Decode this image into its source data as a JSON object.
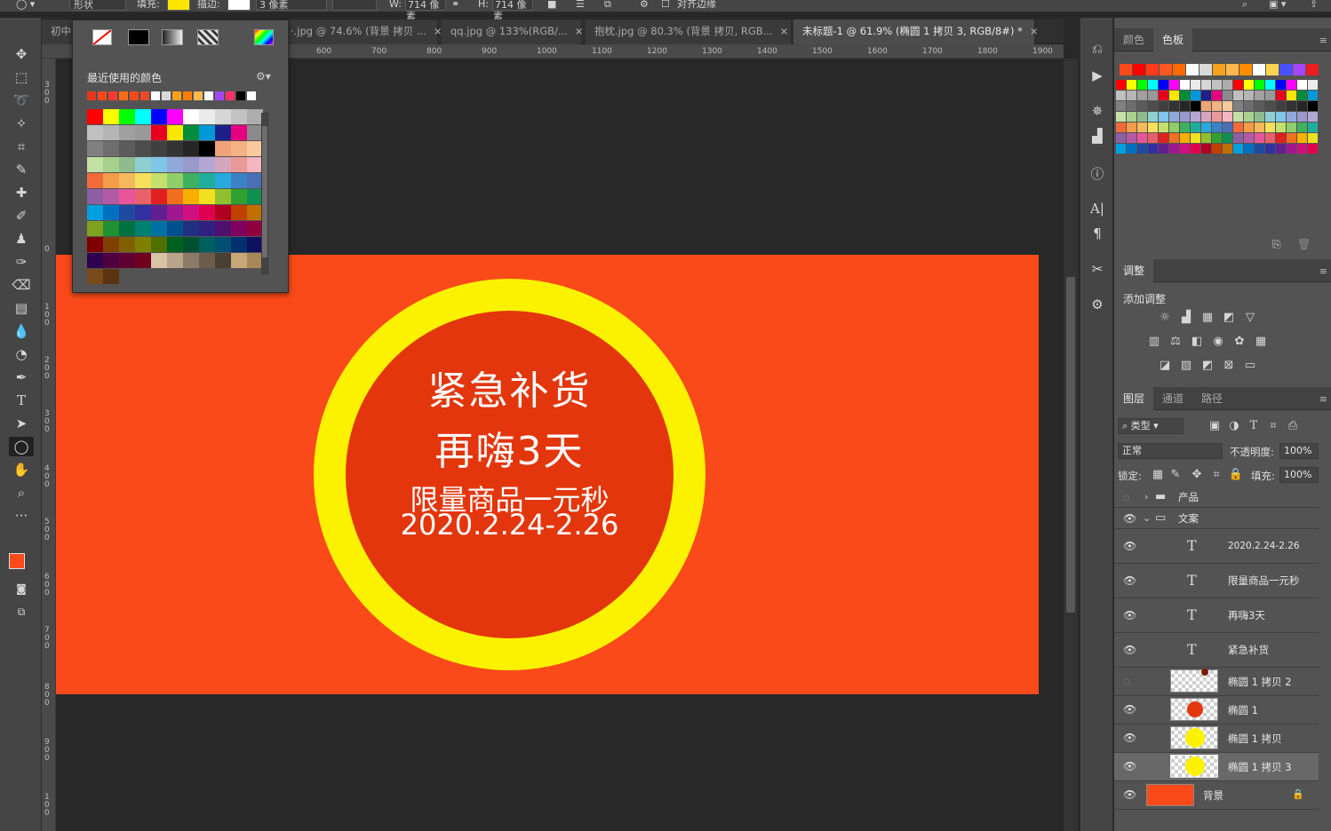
{
  "options_bar": {
    "shape_mode": "形状",
    "fill_label": "填充:",
    "fill_color": "#ffe600",
    "stroke_label": "描边:",
    "stroke_size": "3 像素",
    "width_label": "W:",
    "width_value": "714 像素",
    "height_label": "H:",
    "height_value": "714 像素",
    "align_edges_label": "对齐边缘"
  },
  "tabs": [
    {
      "label": "初中",
      "close": ""
    },
    {
      "label": "·.jpg @ 74.6% (背景 拷贝 ...",
      "close": "×"
    },
    {
      "label": "qq.jpg @ 133%(RGB/...",
      "close": "×"
    },
    {
      "label": "抱枕.jpg @ 80.3% (背景 拷贝, RGB...",
      "close": "×"
    },
    {
      "label": "未标题-1 @ 61.9% (椭圆 1 拷贝 3, RGB/8#) *",
      "close": "×"
    }
  ],
  "ruler": {
    "h_ticks": [
      "600",
      "700",
      "800",
      "900",
      "1000",
      "1100",
      "1200",
      "1300",
      "1400",
      "1500",
      "1600",
      "1700",
      "1800",
      "1900"
    ],
    "v_ticks": [
      "3\n0\n0",
      "0",
      "1\n0\n0",
      "2\n0\n0",
      "3\n0\n0",
      "4\n0\n0",
      "5\n0\n0",
      "6\n0\n0",
      "7\n0\n0",
      "8\n0\n0",
      "9\n0\n0",
      "1\n0\n0"
    ]
  },
  "canvas": {
    "bg_color": "#fb4a19",
    "ring_color": "#fcf200",
    "inner_color": "#e3360c",
    "line1": "紧急补货",
    "line2": "再嗨3天",
    "line3": "限量商品一元秒",
    "line4": "2020.2.24-2.26"
  },
  "swatch_popup": {
    "recent_label": "最近使用的颜色",
    "recent": [
      "#e5371b",
      "#fb4a19",
      "#ff3b30",
      "#ff6b1a",
      "#fb4a19",
      "#e94a27",
      "#ffffff",
      "#d9d9d9",
      "#f7a11c",
      "#ff7f00",
      "#ffb84d",
      "#ffffff",
      "#a347ff",
      "#ff3366",
      "#000000",
      "#ffffff"
    ],
    "grid": [
      [
        "#ff0000",
        "#ffff00",
        "#00ff00",
        "#00ffff",
        "#0000ff",
        "#ff00ff",
        "#ffffff",
        "#ebebeb",
        "#d6d6d6",
        "#c2c2c2",
        "#adadad"
      ],
      [
        "#c0c0c0",
        "#b5b5b5",
        "#a0a0a0",
        "#999999",
        "#e6001e",
        "#ffe600",
        "#008c3a",
        "#0098d9",
        "#1d2088",
        "#e5007f",
        "#8a8a8a"
      ],
      [
        "#808080",
        "#6e6e6e",
        "#5c5c5c",
        "#4d4d4d",
        "#404040",
        "#333333",
        "#262626",
        "#000000",
        "#f0a37a",
        "#f4b183",
        "#f9cb9c"
      ],
      [
        "#c5e0a5",
        "#a9d18e",
        "#8fbc8f",
        "#8ecfd1",
        "#7fc6e8",
        "#8fa9db",
        "#9999cc",
        "#b4a7d6",
        "#d5a6bd",
        "#ea9999",
        "#f4b6c2"
      ],
      [
        "#f26b3a",
        "#f39c4a",
        "#f5b85a",
        "#f7e15c",
        "#c4df6b",
        "#8fce6a",
        "#3fb05e",
        "#1fae9e",
        "#29a8dd",
        "#3b82c4",
        "#4a6fb5"
      ],
      [
        "#8e5ea2",
        "#b35aa5",
        "#e8559a",
        "#e8606a",
        "#e02020",
        "#f07020",
        "#f8b000",
        "#f0e020",
        "#90c030",
        "#30a030",
        "#109050"
      ],
      [
        "#00a0e0",
        "#0070c0",
        "#1e4aa0",
        "#3030a0",
        "#602090",
        "#a01890",
        "#d01080",
        "#e00050",
        "#b00020",
        "#c04000",
        "#c07000"
      ],
      [
        "#80a020",
        "#209030",
        "#007040",
        "#008070",
        "#0070a0",
        "#005090",
        "#203080",
        "#302080",
        "#501070",
        "#800060",
        "#900040"
      ],
      [
        "#800000",
        "#7f3f00",
        "#806000",
        "#808000",
        "#4f6f00",
        "#006020",
        "#005030",
        "#006060",
        "#004f70",
        "#003070",
        "#101060"
      ],
      [
        "#300050",
        "#500040",
        "#600030",
        "#700020",
        "#d9c3a5",
        "#b8a48a",
        "#8c7b66",
        "#6b5c4b",
        "#4a3f33",
        "#c8a878",
        "#a88858"
      ],
      [
        "#7a4b1a",
        "#5a3410",
        "",
        "",
        "",
        "",
        "",
        "",
        "",
        "",
        ""
      ]
    ]
  },
  "panels": {
    "color_tab": "颜色",
    "swatches_tab": "色板",
    "swatch_top": [
      "#fb4a19",
      "#ff0000",
      "#ff3b1a",
      "#ff5722",
      "#ff6a00",
      "#ffffff",
      "#d9d9d9",
      "#f7a11c",
      "#ffb84d",
      "#ff8c00",
      "#ffffff",
      "#ffd54f",
      "#4a52ff",
      "#a347ff",
      "#e91e1e"
    ],
    "adjust_tab": "调整",
    "add_adjust": "添加调整",
    "layers_tab": "图层",
    "channels_tab": "通道",
    "paths_tab": "路径",
    "filter_kind": "类型",
    "blend_mode": "正常",
    "opacity_label": "不透明度:",
    "opacity_value": "100%",
    "lock_label": "锁定:",
    "fill_label": "填充:",
    "fill_value": "100%",
    "layers": [
      {
        "name": "产品",
        "kind": "group",
        "visible": false
      },
      {
        "name": "文案",
        "kind": "group-open",
        "visible": true
      },
      {
        "name": "2020.2.24-2.26",
        "kind": "text",
        "visible": true
      },
      {
        "name": "限量商品一元秒",
        "kind": "text",
        "visible": true
      },
      {
        "name": "再嗨3天",
        "kind": "text",
        "visible": true
      },
      {
        "name": "紧急补货",
        "kind": "text",
        "visible": true
      },
      {
        "name": "椭圆 1 拷贝 2",
        "kind": "shape",
        "visible": false,
        "color": "#7a1a00"
      },
      {
        "name": "椭圆 1",
        "kind": "shape",
        "visible": true,
        "color": "#e3360c"
      },
      {
        "name": "椭圆 1 拷贝",
        "kind": "shape",
        "visible": true,
        "color": "#fcf200"
      },
      {
        "name": "椭圆 1 拷贝 3",
        "kind": "shape",
        "visible": true,
        "color": "#fcf200",
        "selected": true
      },
      {
        "name": "背景",
        "kind": "background",
        "visible": true,
        "color": "#fb4a19"
      }
    ]
  },
  "tool_colors": {
    "foreground": "#fb4a19",
    "background": "#f7b14a"
  }
}
